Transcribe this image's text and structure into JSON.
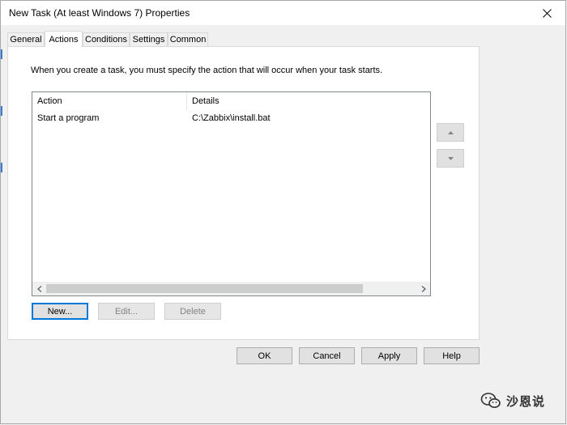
{
  "window": {
    "title": "New Task (At least Windows 7) Properties"
  },
  "tabs": [
    {
      "label": "General",
      "active": false
    },
    {
      "label": "Actions",
      "active": true
    },
    {
      "label": "Conditions",
      "active": false
    },
    {
      "label": "Settings",
      "active": false
    },
    {
      "label": "Common",
      "active": false
    }
  ],
  "actions_tab": {
    "description": "When you create a task, you must specify the action that will occur when your task starts.",
    "columns": [
      "Action",
      "Details"
    ],
    "rows": [
      {
        "action": "Start a program",
        "details": "C:\\Zabbix\\install.bat"
      }
    ],
    "buttons": {
      "new": "New...",
      "edit": "Edit...",
      "delete": "Delete"
    }
  },
  "dialog_buttons": {
    "ok": "OK",
    "cancel": "Cancel",
    "apply": "Apply",
    "help": "Help"
  },
  "watermark": {
    "text": "沙恩说"
  },
  "icons": {
    "close": "close-icon",
    "move_up": "triangle-up-icon",
    "move_down": "triangle-down-icon",
    "scroll_left": "chevron-left-icon",
    "scroll_right": "chevron-right-icon",
    "watermark": "wechat-icon"
  },
  "colors": {
    "accent": "#0078d7",
    "panel": "#ffffff",
    "background": "#f0f0f0"
  }
}
